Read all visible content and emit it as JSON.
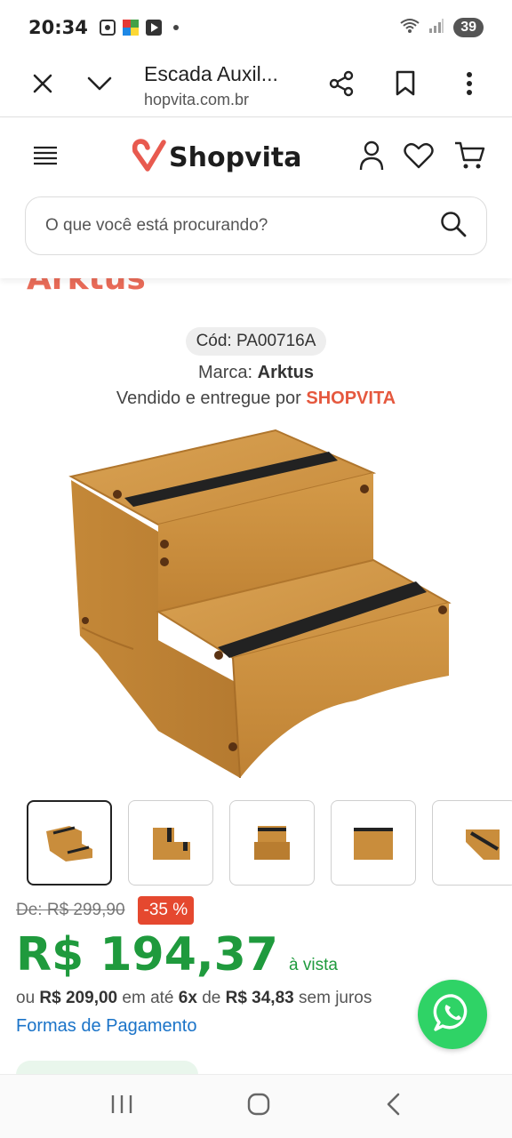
{
  "status_bar": {
    "time": "20:34",
    "battery": "39"
  },
  "browser": {
    "title": "Escada Auxil...",
    "url": "hopvita.com.br"
  },
  "site": {
    "logo_text": "Shopvita",
    "brand_color": "#e85a4f",
    "search": {
      "placeholder": "O que você está procurando?"
    }
  },
  "product": {
    "brand_heading": "Arktus",
    "code": "Cód: PA00716A",
    "brand_label": "Marca:",
    "brand_name": "Arktus",
    "seller_label": "Vendido e entregue por",
    "seller_name": "SHOPVITA",
    "thumbnail_count": 5,
    "old_price": "De: R$ 299,90",
    "discount": "-35 %",
    "price": "R$ 194,37",
    "price_note": "à vista",
    "installment": {
      "prefix": "ou",
      "total": "R$ 209,00",
      "mid": "em até",
      "count": "6x",
      "of": "de",
      "value": "R$ 34,83",
      "suffix": "sem juros"
    },
    "payment_link": "Formas de Pagamento"
  },
  "colors": {
    "price_green": "#1f9a3d",
    "discount_red": "#e5482f",
    "link_blue": "#1a73c8",
    "whatsapp_green": "#2fd366"
  },
  "icons": [
    "close-icon",
    "chevron-down-icon",
    "share-icon",
    "bookmark-icon",
    "more-icon",
    "menu-icon",
    "user-icon",
    "heart-icon",
    "cart-icon",
    "search-icon",
    "whatsapp-icon",
    "recents-icon",
    "home-icon",
    "back-icon"
  ]
}
